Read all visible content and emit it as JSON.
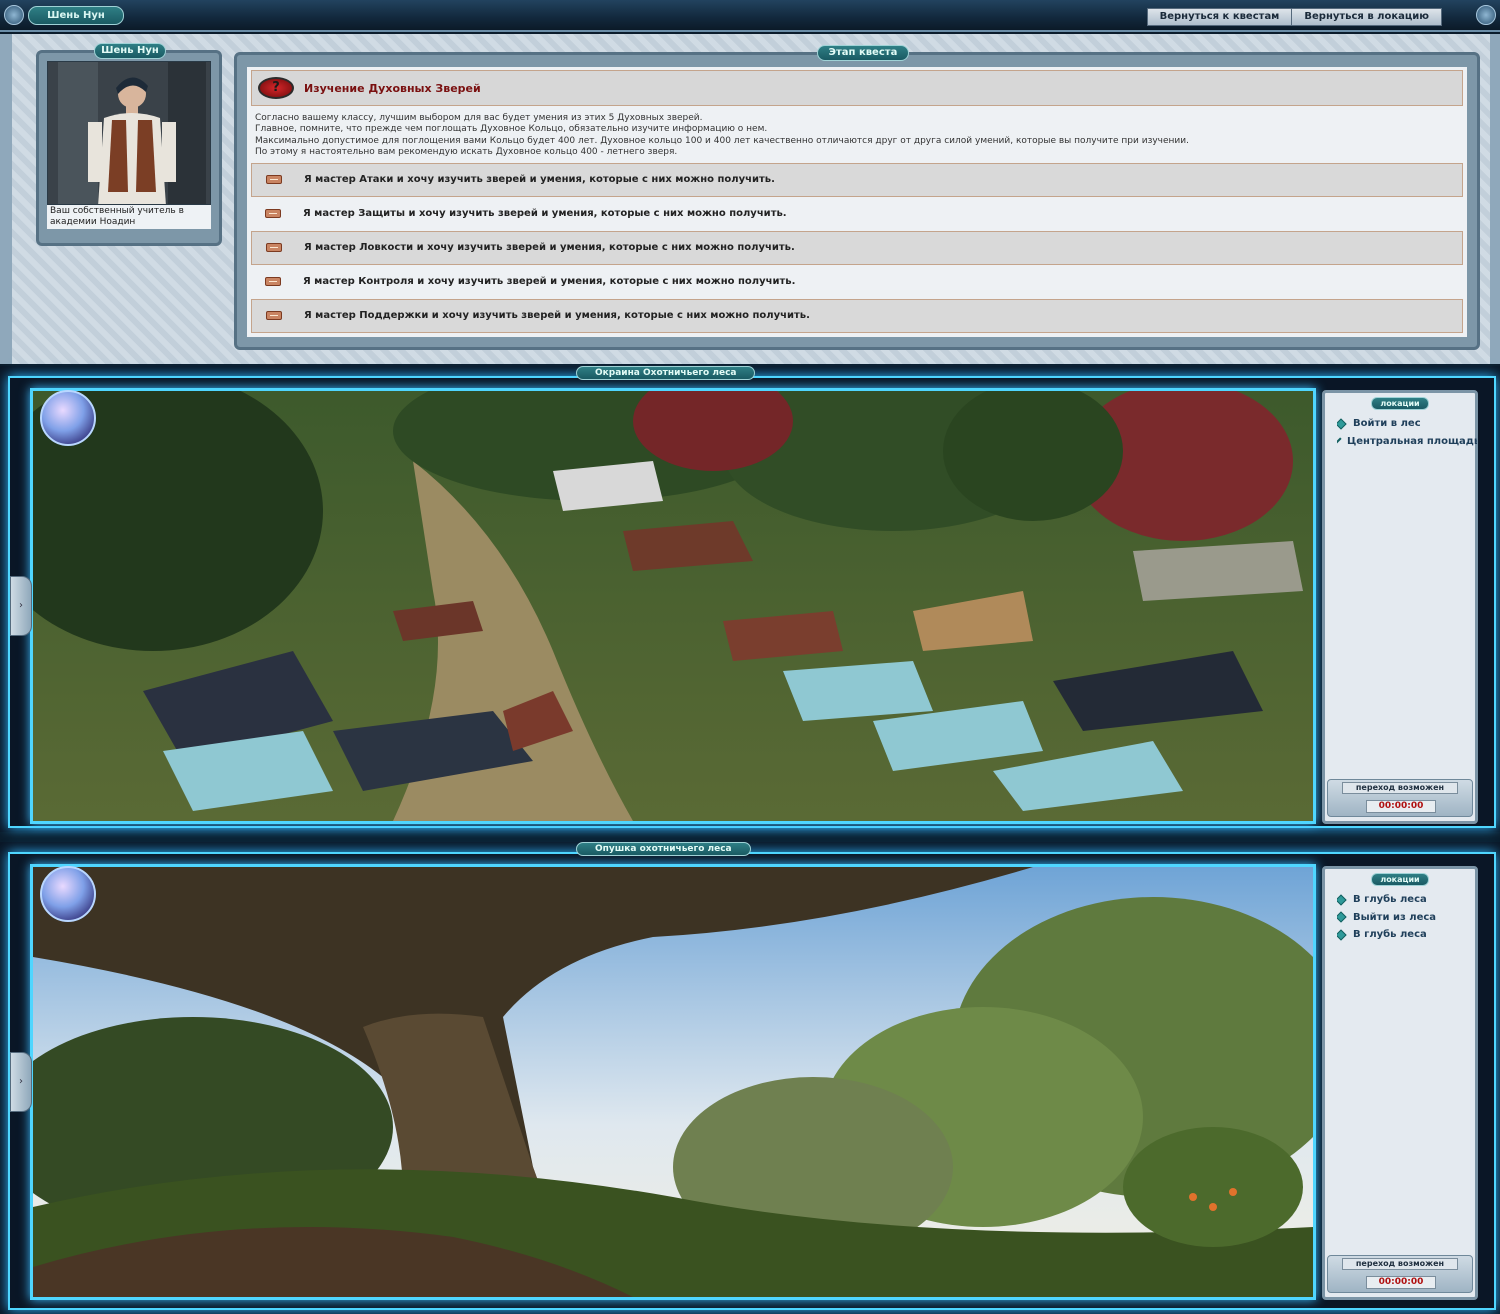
{
  "header": {
    "title": "Шень Нун",
    "buttons": [
      {
        "label": "Вернуться к квестам"
      },
      {
        "label": "Вернуться в локацию"
      }
    ]
  },
  "npc": {
    "plate": "Шень Нун",
    "caption": "Ваш собственный учитель в академии Ноадин"
  },
  "quest": {
    "plate": "Этап квеста",
    "icon": "?",
    "title": "Изучение Духовных Зверей",
    "description": [
      "Согласно вашему классу, лучшим выбором для вас будет умения из этих 5 Духовных зверей.",
      "Главное, помните, что прежде чем поглощать Духовное Кольцо, обязательно изучите информацию о нем.",
      "Максимально допустимое для поглощения вами Кольцо будет 400 лет. Духовное кольцо 100 и 400 лет качественно отличаются друг от друга силой умений, которые вы получите при изучении.",
      "По этому я настоятельно вам рекомендую искать Духовное кольцо 400 - летнего зверя."
    ],
    "options": [
      {
        "label": "Я мастер Атаки и хочу изучить зверей и умения, которые с них можно получить."
      },
      {
        "label": "Я мастер Защиты и хочу изучить зверей и умения, которые с них можно получить."
      },
      {
        "label": "Я мастер Ловкости и хочу изучить зверей и умения, которые с них можно получить."
      },
      {
        "label": "Я мастер Контроля и хочу изучить зверей и умения, которые с них можно получить."
      },
      {
        "label": "Я мастер Поддержки и хочу изучить зверей и умения, которые с них можно получить."
      }
    ]
  },
  "locations": [
    {
      "title": "Окраина Охотничьего леса",
      "panel_label": "локации",
      "links": [
        {
          "label": "Войти в лес"
        },
        {
          "label": "Центральная площадь"
        }
      ],
      "status": "переход возможен",
      "timer": "00:00:00"
    },
    {
      "title": "Опушка охотничьего леса",
      "panel_label": "локации",
      "links": [
        {
          "label": "В глубь леса"
        },
        {
          "label": "Выйти из леса"
        },
        {
          "label": "В глубь леса"
        }
      ],
      "status": "переход возможен",
      "timer": "00:00:00"
    }
  ],
  "icons": {
    "quest": "question-icon",
    "option": "scroll-icon",
    "link": "diamond-bullet-icon",
    "globe": "globe-icon",
    "side_tab": "chevron-right-icon",
    "side_tab_glyph": "›"
  },
  "colors": {
    "accent_glow": "#4fd6ff",
    "quest_title": "#7a1010",
    "timer": "#b01010",
    "plate": "#1a5a63"
  }
}
